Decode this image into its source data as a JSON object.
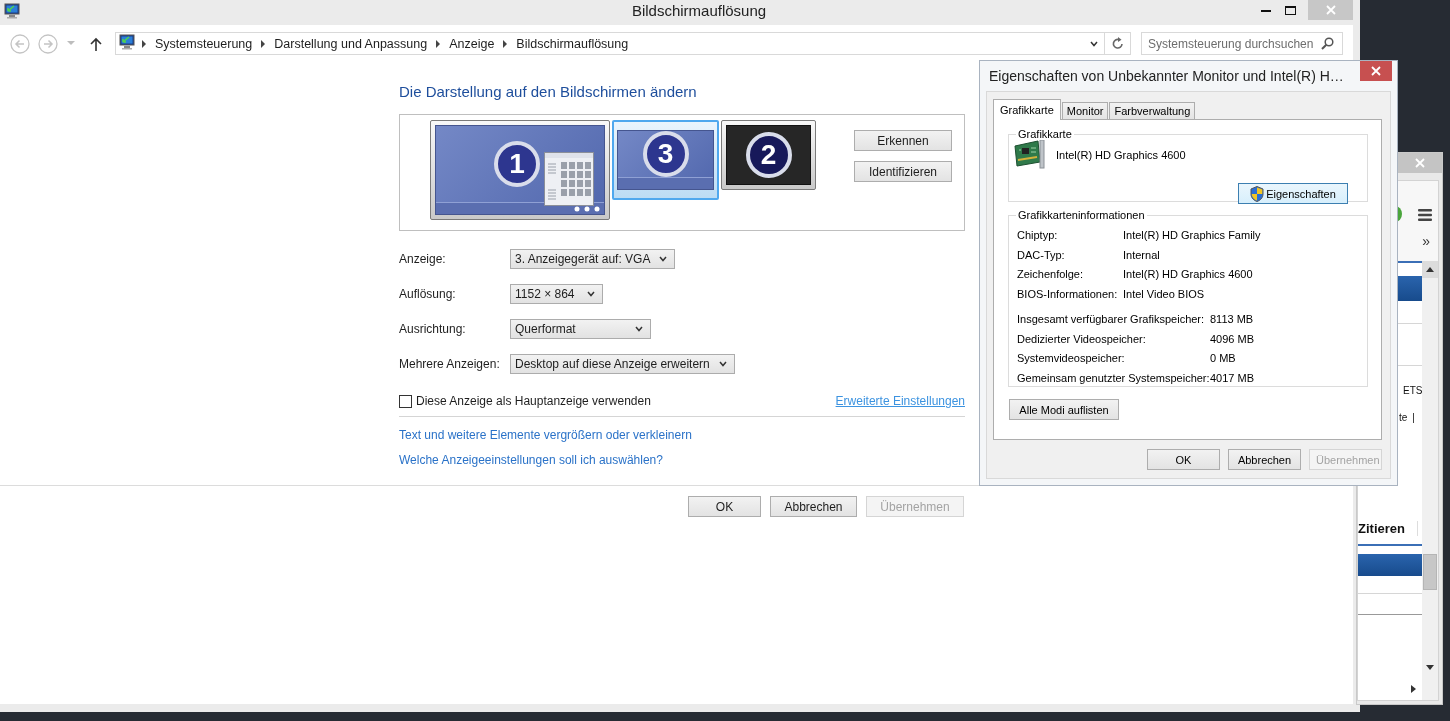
{
  "window": {
    "title": "Bildschirmauflösung"
  },
  "address_bar": {
    "breadcrumb": [
      "Systemsteuerung",
      "Darstellung und Anpassung",
      "Anzeige",
      "Bildschirmauflösung"
    ]
  },
  "search": {
    "placeholder": "Systemsteuerung durchsuchen"
  },
  "heading": "Die Darstellung auf den Bildschirmen ändern",
  "monitors": [
    {
      "number": "1",
      "kind": "primary",
      "selected": false
    },
    {
      "number": "3",
      "kind": "extended",
      "selected": true
    },
    {
      "number": "2",
      "kind": "inactive",
      "selected": false
    }
  ],
  "monitor_buttons": [
    "Erkennen",
    "Identifizieren"
  ],
  "settings": [
    {
      "label": "Anzeige:",
      "value": "3. Anzeigegerät auf: VGA"
    },
    {
      "label": "Auflösung:",
      "value": "1152 × 864"
    },
    {
      "label": "Ausrichtung:",
      "value": "Querformat"
    },
    {
      "label": "Mehrere Anzeigen:",
      "value": "Desktop auf diese Anzeige erweitern"
    }
  ],
  "main_display_checkbox": {
    "label": "Diese Anzeige als Hauptanzeige verwenden",
    "checked": false
  },
  "advanced_link": "Erweiterte Einstellungen",
  "help_links": [
    "Text und weitere Elemente vergrößern oder verkleinern",
    "Welche Anzeigeeinstellungen soll ich auswählen?"
  ],
  "buttons": [
    {
      "label": "OK",
      "disabled": false
    },
    {
      "label": "Abbrechen",
      "disabled": false
    },
    {
      "label": "Übernehmen",
      "disabled": true
    }
  ],
  "dialog": {
    "title": "Eigenschaften von Unbekannter Monitor und Intel(R) H…",
    "tabs": [
      {
        "label": "Grafikkarte",
        "selected": true
      },
      {
        "label": "Monitor",
        "selected": false
      },
      {
        "label": "Farbverwaltung",
        "selected": false
      }
    ],
    "adapter": {
      "group_title": "Grafikkarte",
      "name": "Intel(R) HD Graphics 4600",
      "button": "Eigenschaften"
    },
    "info": {
      "group_title": "Grafikkarteninformationen",
      "rows": [
        {
          "label": "Chiptyp:",
          "value": "Intel(R) HD Graphics Family"
        },
        {
          "label": "DAC-Typ:",
          "value": "Internal"
        },
        {
          "label": "Zeichenfolge:",
          "value": "Intel(R) HD Graphics 4600"
        },
        {
          "label": "BIOS-Informationen:",
          "value": "Intel Video BIOS"
        }
      ],
      "memory_rows": [
        {
          "label": "Insgesamt verfügbarer Grafikspeicher:",
          "value": "8113 MB"
        },
        {
          "label": "Dedizierter Videospeicher:",
          "value": "4096 MB"
        },
        {
          "label": "Systemvideospeicher:",
          "value": "0 MB"
        },
        {
          "label": "Gemeinsam genutzter Systemspeicher:",
          "value": "4017 MB"
        }
      ]
    },
    "list_modes_button": "Alle Modi auflisten",
    "buttons": [
      {
        "label": "OK",
        "disabled": false
      },
      {
        "label": "Abbrechen",
        "disabled": false
      },
      {
        "label": "Übernehmen",
        "disabled": true
      }
    ]
  },
  "browser_window": {
    "overflow_button": "»",
    "lines": [
      {
        "parts": [
          "ETS"
        ]
      },
      {
        "parts": [
          "te",
          "|"
        ]
      }
    ],
    "tab": "Zitieren"
  }
}
